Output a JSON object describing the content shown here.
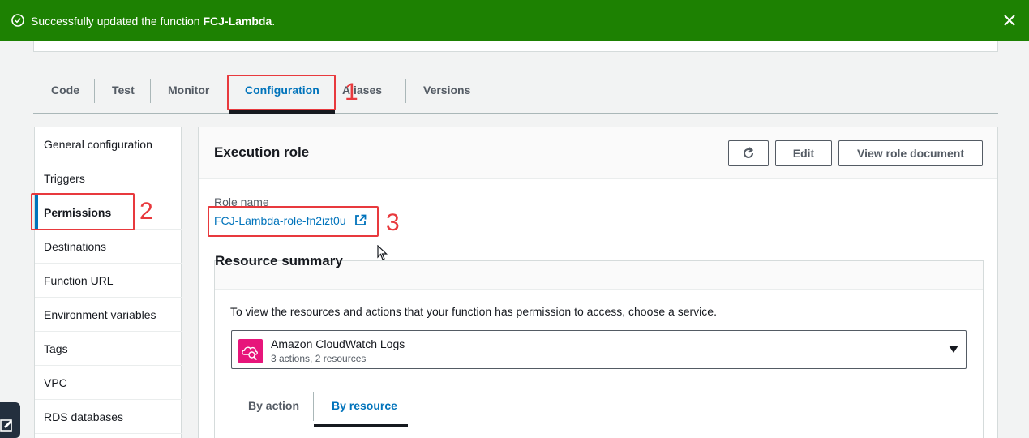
{
  "flash": {
    "message_prefix": "Successfully updated the function ",
    "function_name": "FCJ-Lambda",
    "message_suffix": ".",
    "icon": "check-circle-icon",
    "color": "#1d8102"
  },
  "tabs": [
    {
      "label": "Code"
    },
    {
      "label": "Test"
    },
    {
      "label": "Monitor"
    },
    {
      "label": "Configuration",
      "active": true
    },
    {
      "label": "Aliases"
    },
    {
      "label": "Versions"
    }
  ],
  "sidebar": {
    "items": [
      {
        "label": "General configuration"
      },
      {
        "label": "Triggers"
      },
      {
        "label": "Permissions",
        "active": true
      },
      {
        "label": "Destinations"
      },
      {
        "label": "Function URL"
      },
      {
        "label": "Environment variables"
      },
      {
        "label": "Tags"
      },
      {
        "label": "VPC"
      },
      {
        "label": "RDS databases"
      }
    ]
  },
  "execution_role": {
    "title": "Execution role",
    "refresh_icon": "refresh-icon",
    "edit_label": "Edit",
    "view_doc_label": "View role document",
    "role_name_label": "Role name",
    "role_name": "FCJ-Lambda-role-fn2izt0u"
  },
  "resource_summary": {
    "title": "Resource summary",
    "description": "To view the resources and actions that your function has permission to access, choose a service.",
    "selected_service": {
      "name": "Amazon CloudWatch Logs",
      "details": "3 actions, 2 resources",
      "icon": "cloudwatch-logs-icon",
      "icon_color": "#e7157b"
    },
    "subtabs": [
      {
        "label": "By action"
      },
      {
        "label": "By resource",
        "active": true
      }
    ]
  },
  "annotations": [
    "1",
    "2",
    "3"
  ],
  "colors": {
    "accent": "#0073bb",
    "callout": "#e8393d"
  }
}
